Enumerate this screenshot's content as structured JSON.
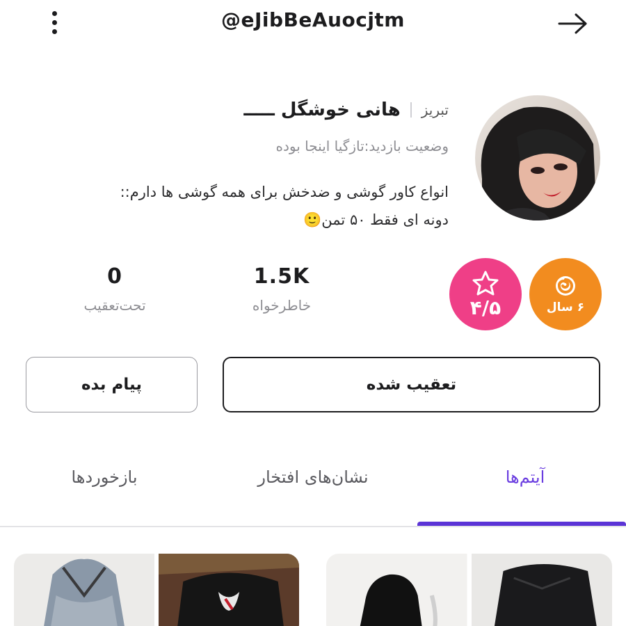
{
  "header": {
    "username": "@eJibBeAuocjtm",
    "menu_icon": "more-vertical-icon",
    "back_icon": "arrow-right-icon"
  },
  "profile": {
    "display_name": "هانی خوشگل ـــــ",
    "city": "تبریز",
    "status": "وضعیت بازدید:تازگیا اینجا بوده",
    "bio_line1": "انواع کاور گوشی و ضدخش برای همه گوشی ها دارم::",
    "bio_line2": "دونه ای فقط ۵۰ تمن🙂"
  },
  "badges": {
    "years_label": "۶ سال",
    "rating_label": "۴/۵",
    "years_color": "#f28c1f",
    "rating_color": "#ef3f87"
  },
  "stats": {
    "followers_count": "1.5K",
    "followers_label": "خاطرخواه",
    "following_count": "0",
    "following_label": "تحت‌تعقیب"
  },
  "actions": {
    "follow_label": "تعقیب شده",
    "message_label": "پیام بده"
  },
  "tabs": {
    "items": "آیتم‌ها",
    "badges": "نشان‌های افتخار",
    "feedback": "بازخوردها",
    "active_color": "#5b34d6"
  }
}
